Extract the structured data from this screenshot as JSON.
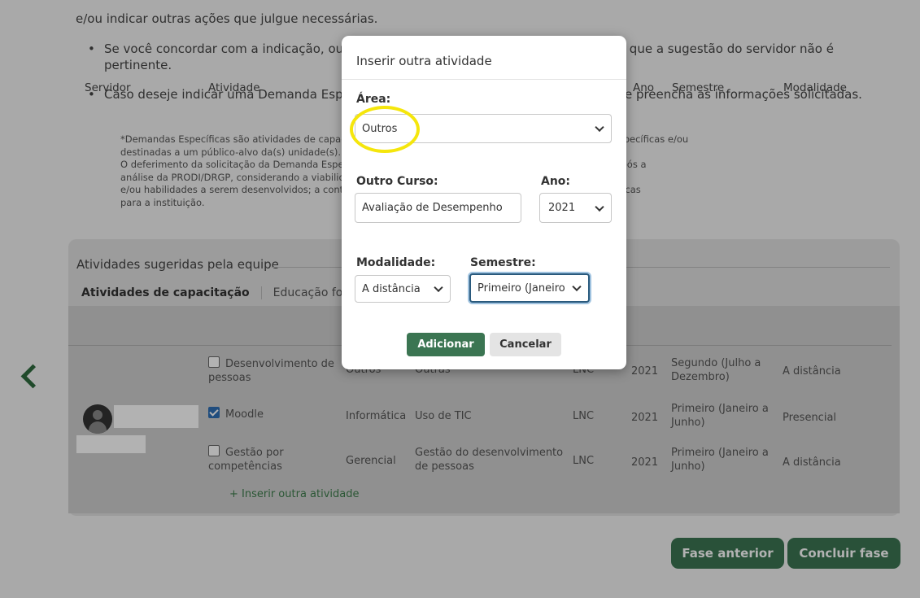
{
  "intro": "e/ou indicar outras ações que julgue necessárias.",
  "bullets": [
    "Se você concordar com a indicação, ou se discordar, marque a opção que representa que a sugestão do servidor não é pertinente.",
    "Caso deseje indicar uma Demanda Específica*, clique em \"+ Inserir outra atividade\" e preencha as informações solicitadas."
  ],
  "note": [
    "*Demandas Específicas são atividades de capacitação solicitadas para atender necessidades formativas específicas e/ou",
    "destinadas a um público-alvo da(s) unidade(s).",
    "O deferimento da solicitação da Demanda Específica depende da Gestão de Pessoas e somente ocorrerá após a",
    "análise da PRODI/DRGP, considerando a viabilidade, a aplicabilidade/relevância dos conhecimentos",
    "e/ou habilidades a serem desenvolvidos; a contribuição para o desenvolvimento de competências estratégicas",
    "para a instituição."
  ],
  "card": {
    "legend": "Atividades sugeridas pela equipe",
    "tab_active": "Atividades de capacitação",
    "tab_other": "Educação formal",
    "headers": {
      "servidor": "Servidor",
      "atividade": "Atividade",
      "ano": "Ano",
      "semestre": "Semestre",
      "modalidade": "Modalidade"
    },
    "rows": [
      {
        "atividade": "Desenvolvimento de pessoas",
        "checked": false,
        "area": "Outros",
        "tema": "Outras",
        "tipo": "LNC",
        "ano": "2021",
        "semestre": "Segundo (Julho a Dezembro)",
        "modalidade": "A distância"
      },
      {
        "atividade": "Moodle",
        "checked": true,
        "area": "Informática",
        "tema": "Uso de TIC",
        "tipo": "LNC",
        "ano": "2021",
        "semestre": "Primeiro (Janeiro a Junho)",
        "modalidade": "Presencial"
      },
      {
        "atividade": "Gestão por competências",
        "checked": false,
        "area": "Gerencial",
        "tema": "Gestão do desenvolvimento de pessoas",
        "tipo": "LNC",
        "ano": "2021",
        "semestre": "Primeiro (Janeiro a Junho)",
        "modalidade": "A distância"
      }
    ],
    "insert_link": "+ Inserir outra atividade"
  },
  "buttons": {
    "previous": "Fase anterior",
    "finish": "Concluir fase"
  },
  "modal": {
    "title": "Inserir outra atividade",
    "area_label": "Área:",
    "area_value": "Outros",
    "outro_curso_label": "Outro Curso:",
    "outro_curso_value": "Avaliação de Desempenho",
    "ano_label": "Ano:",
    "ano_value": "2021",
    "modalidade_label": "Modalidade:",
    "modalidade_value": "A distância",
    "semestre_label": "Semestre:",
    "semestre_value": "Primeiro (Janeiro",
    "add": "Adicionar",
    "cancel": "Cancelar"
  },
  "colors": {
    "green": "#3b7552",
    "highlight": "#f5e60c",
    "checkbox": "#2f6fb5"
  }
}
